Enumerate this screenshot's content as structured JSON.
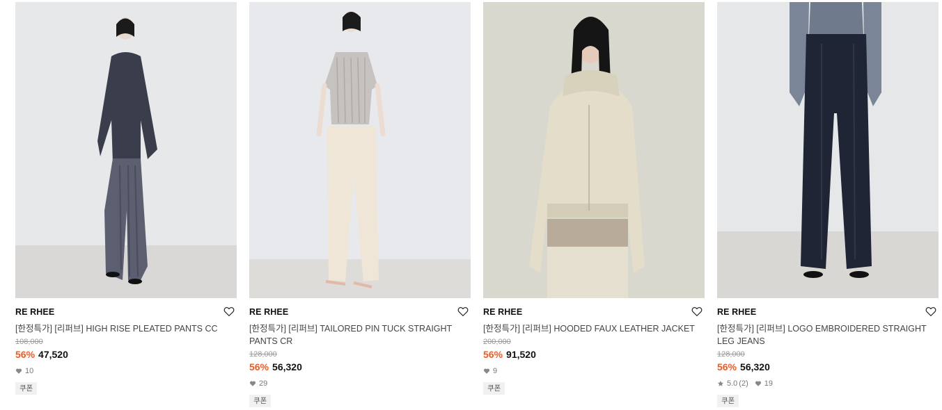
{
  "products": [
    {
      "brand": "RE RHEE",
      "title": "[한정특가] [리퍼브] HIGH RISE PLEATED PANTS CC",
      "original_price": "108,000",
      "discount": "56%",
      "price": "47,520",
      "likes": "10",
      "rating": null,
      "coupon": "쿠폰",
      "image_alt": "Model in dark satin shirt and grey pleated flared pants",
      "icons": {
        "wishlist": "heart-outline-icon",
        "likes": "heart-filled-icon"
      }
    },
    {
      "brand": "RE RHEE",
      "title": "[한정특가] [리퍼브] TAILORED PIN TUCK STRAIGHT PANTS CR",
      "original_price": "128,000",
      "discount": "56%",
      "price": "56,320",
      "likes": "29",
      "rating": null,
      "coupon": "쿠폰",
      "image_alt": "Model in knit polo top and cream tailored pants",
      "icons": {
        "wishlist": "heart-outline-icon",
        "likes": "heart-filled-icon"
      }
    },
    {
      "brand": "RE RHEE",
      "title": "[한정특가] [리퍼브] HOODED FAUX LEATHER JACKET",
      "original_price": "200,000",
      "discount": "56%",
      "price": "91,520",
      "likes": "9",
      "rating": null,
      "coupon": "쿠폰",
      "image_alt": "Model in cream hooded faux leather jacket",
      "icons": {
        "wishlist": "heart-outline-icon",
        "likes": "heart-filled-icon"
      }
    },
    {
      "brand": "RE RHEE",
      "title": "[한정특가] [리퍼브] LOGO EMBROIDERED STRAIGHT LEG JEANS",
      "original_price": "128,000",
      "discount": "56%",
      "price": "56,320",
      "likes": "19",
      "rating": "5.0",
      "rating_count": "(2)",
      "coupon": "쿠폰",
      "image_alt": "Model in dark indigo straight leg jeans",
      "icons": {
        "wishlist": "heart-outline-icon",
        "likes": "heart-filled-icon",
        "rating": "star-icon"
      }
    }
  ],
  "colors": {
    "discount": "#f05a24",
    "text": "#111111",
    "muted": "#999999"
  }
}
